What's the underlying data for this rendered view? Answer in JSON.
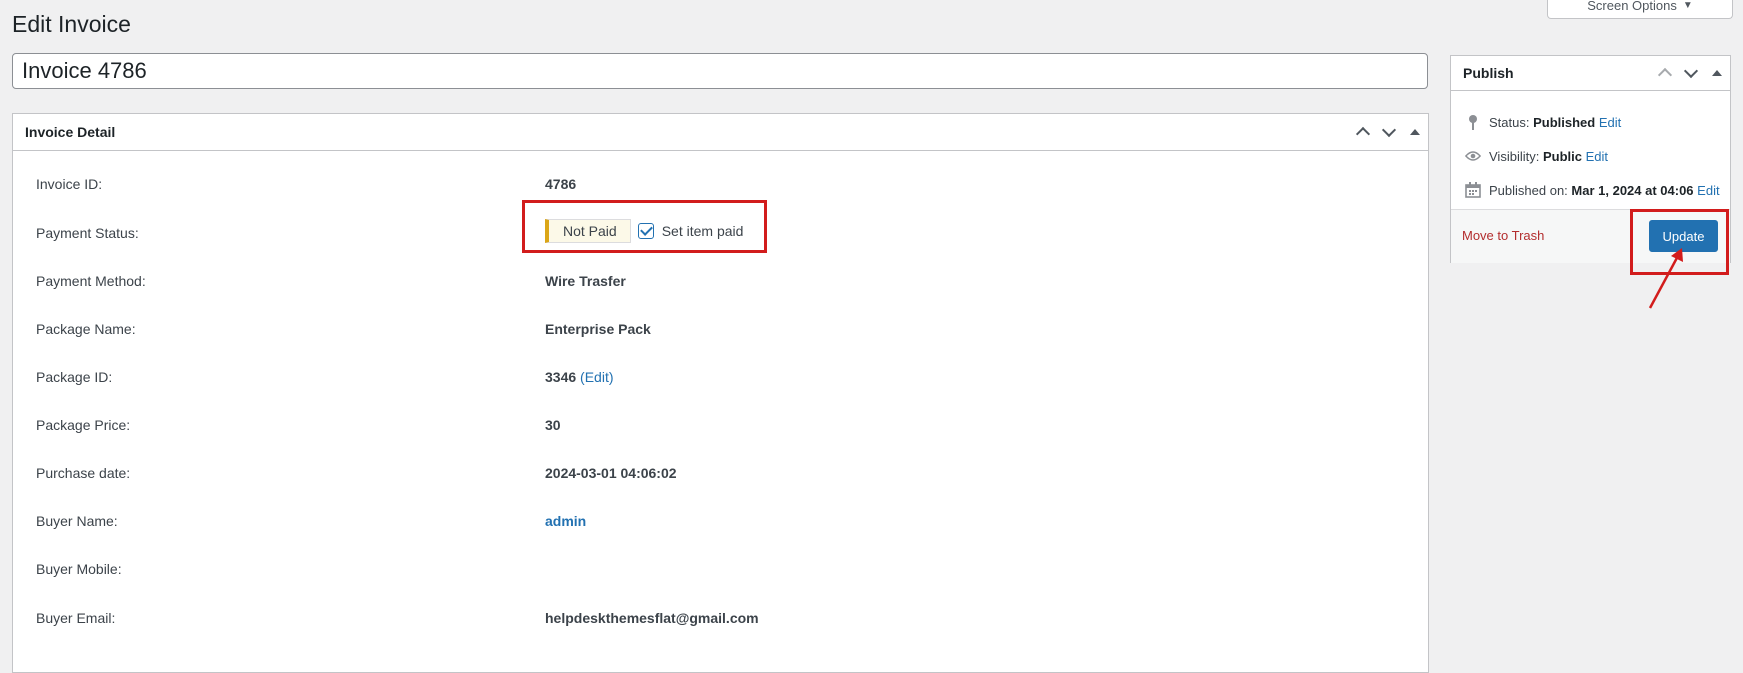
{
  "header": {
    "title": "Edit Invoice",
    "screen_options": "Screen Options",
    "screen_options_caret": "▼"
  },
  "post_title": "Invoice 4786",
  "invoice_detail": {
    "title": "Invoice Detail",
    "rows": [
      {
        "label": "Invoice ID:",
        "value": "4786"
      },
      {
        "label": "Payment Status:",
        "status_badge": "Not Paid",
        "checkbox_label": "Set item paid",
        "checkbox_checked": true
      },
      {
        "label": "Payment Method:",
        "value": "Wire Trasfer"
      },
      {
        "label": "Package Name:",
        "value": "Enterprise Pack"
      },
      {
        "label": "Package ID:",
        "value": "3346",
        "edit_link": "(Edit)"
      },
      {
        "label": "Package Price:",
        "value": "30"
      },
      {
        "label": "Purchase date:",
        "value": "2024-03-01 04:06:02"
      },
      {
        "label": "Buyer Name:",
        "value": "admin"
      },
      {
        "label": "Buyer Mobile:",
        "value": ""
      },
      {
        "label": "Buyer Email:",
        "value": "helpdeskthemesflat@gmail.com"
      }
    ]
  },
  "publish": {
    "title": "Publish",
    "status_label": "Status:",
    "status_value": "Published",
    "visibility_label": "Visibility:",
    "visibility_value": "Public",
    "published_label": "Published on:",
    "published_value": "Mar 1, 2024 at 04:06",
    "edit_link": "Edit",
    "trash_label": "Move to Trash",
    "update_label": "Update"
  },
  "colors": {
    "accent": "#2271b1",
    "annotation": "#d21c1c",
    "badge_border": "#dba617",
    "trash": "#b32d2e"
  }
}
